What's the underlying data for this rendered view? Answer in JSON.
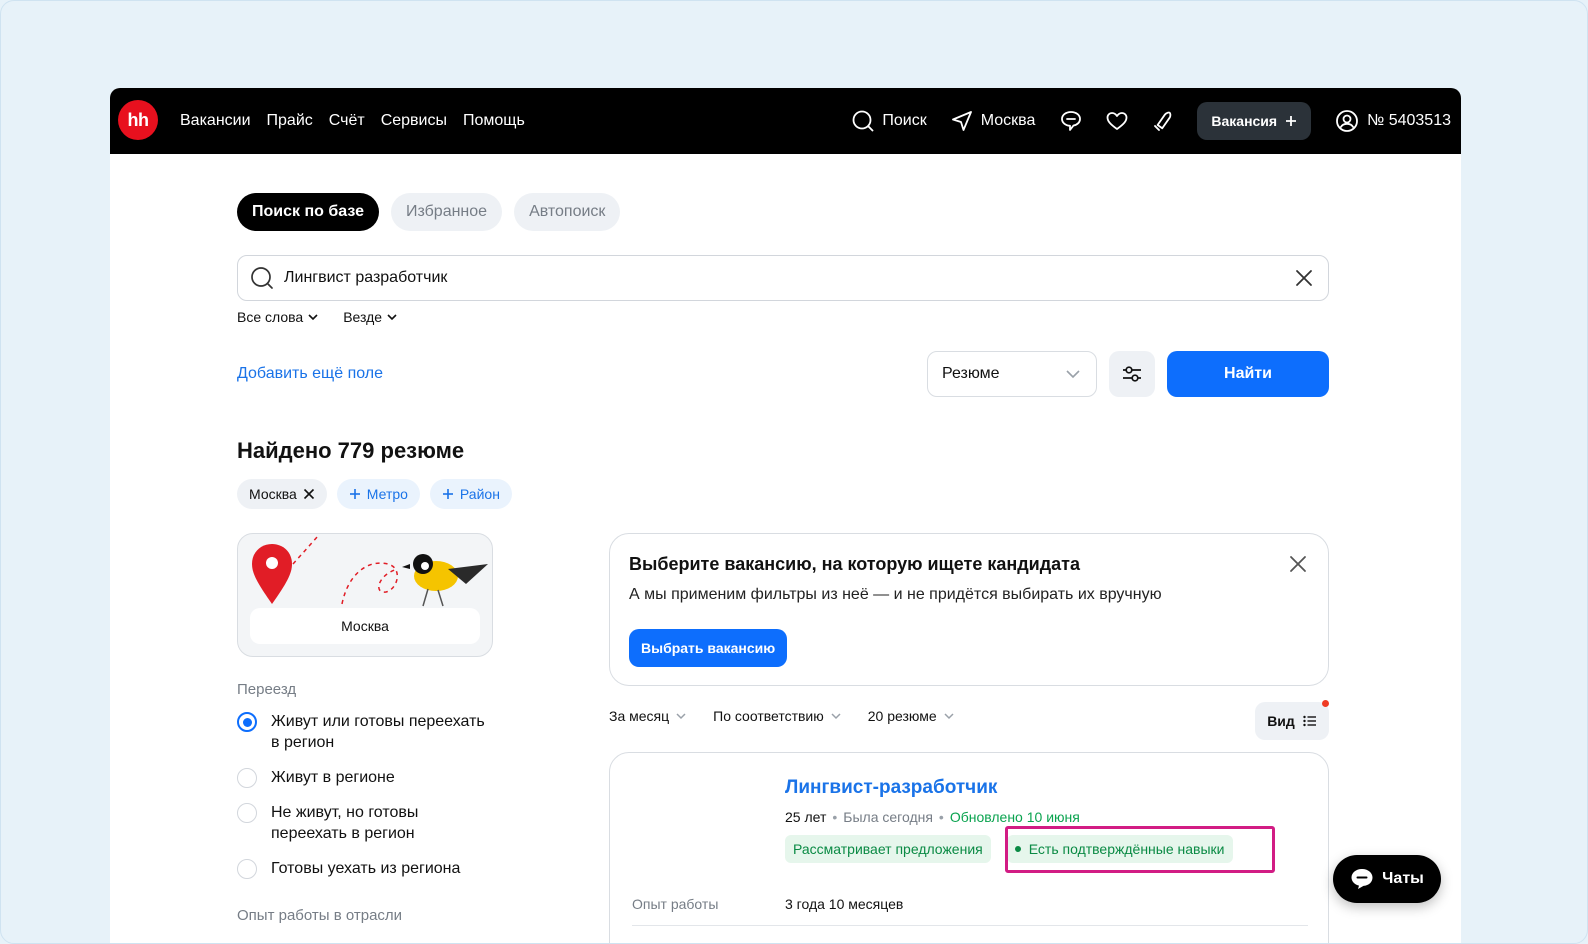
{
  "nav": {
    "logo": "hh",
    "links": [
      "Вакансии",
      "Прайс",
      "Счёт",
      "Сервисы",
      "Помощь"
    ],
    "search_label": "Поиск",
    "city_label": "Москва",
    "vacancy_btn": "Вакансия",
    "account": "№ 5403513"
  },
  "tabs": [
    "Поиск по базе",
    "Избранное",
    "Автопоиск"
  ],
  "search": {
    "value": "Лингвист разработчик",
    "word_mode": "Все слова",
    "scope": "Везде"
  },
  "add_field": "Добавить ещё поле",
  "select_type": "Резюме",
  "find_btn": "Найти",
  "found_title": "Найдено 779 резюме",
  "chips": {
    "city": "Москва",
    "metro": "Метро",
    "district": "Район"
  },
  "map_card": {
    "label": "Москва"
  },
  "relocation": {
    "title": "Переезд",
    "options": [
      "Живут или готовы переехать в регион",
      "Живут в регионе",
      "Не живут, но готовы переехать в регион",
      "Готовы уехать из региона"
    ],
    "selected_index": 0
  },
  "experience_title": "Опыт работы в отрасли",
  "promo": {
    "title": "Выберите вакансию, на которую ищете кандидата",
    "text": "А мы применим фильтры из неё — и не придётся выбирать их вручную",
    "button": "Выбрать вакансию"
  },
  "sorting": {
    "period": "За месяц",
    "order": "По соответствию",
    "count": "20 резюме",
    "view": "Вид"
  },
  "resume": {
    "title": "Лингвист-разработчик",
    "age": "25 лет",
    "last_seen": "Была сегодня",
    "updated": "Обновлено 10 июня",
    "badge_offers": "Рассматривает предложения",
    "badge_skills": "Есть подтверждённые навыки",
    "exp_label": "Опыт работы",
    "exp_value": "3 года 10 месяцев"
  },
  "chats_btn": "Чаты",
  "colors": {
    "brand_red": "#e8101e",
    "primary_blue": "#0d6efd",
    "link_blue": "#1a73e8",
    "success_green": "#0a8a44",
    "highlight": "#d21c84"
  }
}
